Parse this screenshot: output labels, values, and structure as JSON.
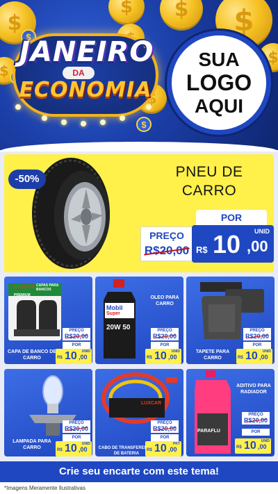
{
  "header": {
    "title_line1": "JANEIRO",
    "title_line2": "DA",
    "title_line3": "ECONOMIA",
    "logo_line1": "SUA",
    "logo_line2": "LOGO",
    "logo_line3": "AQUI",
    "dollar_symbol": "$"
  },
  "hero": {
    "discount": "-50%",
    "title_line1": "PNEU DE",
    "title_line2": "CARRO",
    "preco_label": "PREÇO",
    "old_price": "R$20,00",
    "por_label": "POR",
    "unit_label": "UNID",
    "currency": "R$",
    "price_int": "10",
    "price_dec": ",00",
    "product_icon": "tire-icon"
  },
  "products": [
    {
      "name": "CAPA DE BANCO DE CARRO",
      "preco_label": "PREÇO",
      "old_price": "R$20,00",
      "por_label": "POR",
      "unit_label": "UNID",
      "currency": "R$",
      "price_int": "10",
      "price_dec": ",00",
      "icon": "seat-cover-icon",
      "package_brand": "LUXCAR",
      "package_text": "CAPAS PARA BANCOS",
      "package_tag": "PREMIUM"
    },
    {
      "name": "OLEO PARA CARRO",
      "preco_label": "PREÇO",
      "old_price": "R$20,00",
      "por_label": "POR",
      "unit_label": "UNID",
      "currency": "R$",
      "price_int": "10",
      "price_dec": ",00",
      "icon": "oil-bottle-icon",
      "package_brand": "Mobil",
      "package_text": "Super",
      "package_tag": "20W 50"
    },
    {
      "name": "TAPETE PARA CARRO",
      "preco_label": "PREÇO",
      "old_price": "R$20,00",
      "por_label": "POR",
      "unit_label": "UNID",
      "currency": "R$",
      "price_int": "10",
      "price_dec": ",00",
      "icon": "car-mat-icon",
      "package_brand": "",
      "package_text": "",
      "package_tag": ""
    },
    {
      "name": "LAMPADA PARA CARRO",
      "preco_label": "PREÇO",
      "old_price": "R$20,00",
      "por_label": "POR",
      "unit_label": "UNID",
      "currency": "R$",
      "price_int": "10",
      "price_dec": ",00",
      "icon": "headlight-bulb-icon",
      "package_brand": "",
      "package_text": "",
      "package_tag": ""
    },
    {
      "name": "CABO DE TRANSFERENCIA DE BATERIA",
      "preco_label": "PREÇO",
      "old_price": "R$20,00",
      "por_label": "POR",
      "unit_label": "PKT",
      "currency": "R$",
      "price_int": "10",
      "price_dec": ",00",
      "icon": "jumper-cable-icon",
      "package_brand": "LUXCAR",
      "package_text": "",
      "package_tag": ""
    },
    {
      "name": "ADITIVO PARA RADIADOR",
      "preco_label": "PREÇO",
      "old_price": "R$20,00",
      "por_label": "POR",
      "unit_label": "UNID",
      "currency": "R$",
      "price_int": "10",
      "price_dec": ",00",
      "icon": "radiator-additive-icon",
      "package_brand": "PARAFLU",
      "package_text": "",
      "package_tag": ""
    }
  ],
  "footer": {
    "cta": "Crie seu encarte com este tema!",
    "disclaimer": "*Imagens Meramente Ilustrativas"
  },
  "colors": {
    "brand_blue": "#1f47c1",
    "highlight_yellow": "#fff04a",
    "strike_red": "#c01020",
    "header_dark": "#0f2670"
  }
}
